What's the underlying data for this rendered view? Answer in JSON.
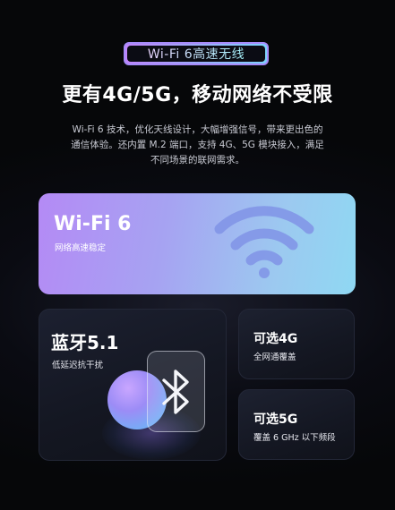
{
  "badge": {
    "label": "Wi-Fi 6高速无线"
  },
  "headline": "更有4G/5G，移动网络不受限",
  "description": {
    "line1": "Wi-Fi 6 技术，优化天线设计，大幅增强信号，带来更出色的",
    "line2": "通信体验。还内置 M.2 端口，支持 4G、5G 模块接入，满足",
    "line3": "不同场景的联网需求。"
  },
  "cards": {
    "wifi": {
      "title": "Wi-Fi 6",
      "subtitle": "网络高速稳定",
      "icon": "wifi-icon"
    },
    "bluetooth": {
      "title": "蓝牙5.1",
      "subtitle": "低延迟抗干扰",
      "icon": "bluetooth-icon"
    },
    "opt4g": {
      "title": "可选4G",
      "subtitle": "全网通覆盖"
    },
    "opt5g": {
      "title": "可选5G",
      "subtitle": "覆盖 6 GHz 以下频段"
    }
  },
  "colors": {
    "background": "#07080c",
    "wifi_gradient_start": "#b48af5",
    "wifi_gradient_end": "#8fd8f3",
    "wifi_icon": "#7f93e6",
    "card_dark": "#141722"
  }
}
